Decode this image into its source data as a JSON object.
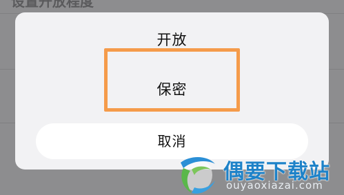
{
  "background": {
    "title": "设置开放程度"
  },
  "action_sheet": {
    "options": [
      {
        "label": "开放"
      },
      {
        "label": "保密"
      }
    ],
    "cancel_label": "取消",
    "highlight_color": "#f59b4a"
  },
  "watermark": {
    "brand": "偶要下载站",
    "url": "ouyaoxiazai.com"
  }
}
